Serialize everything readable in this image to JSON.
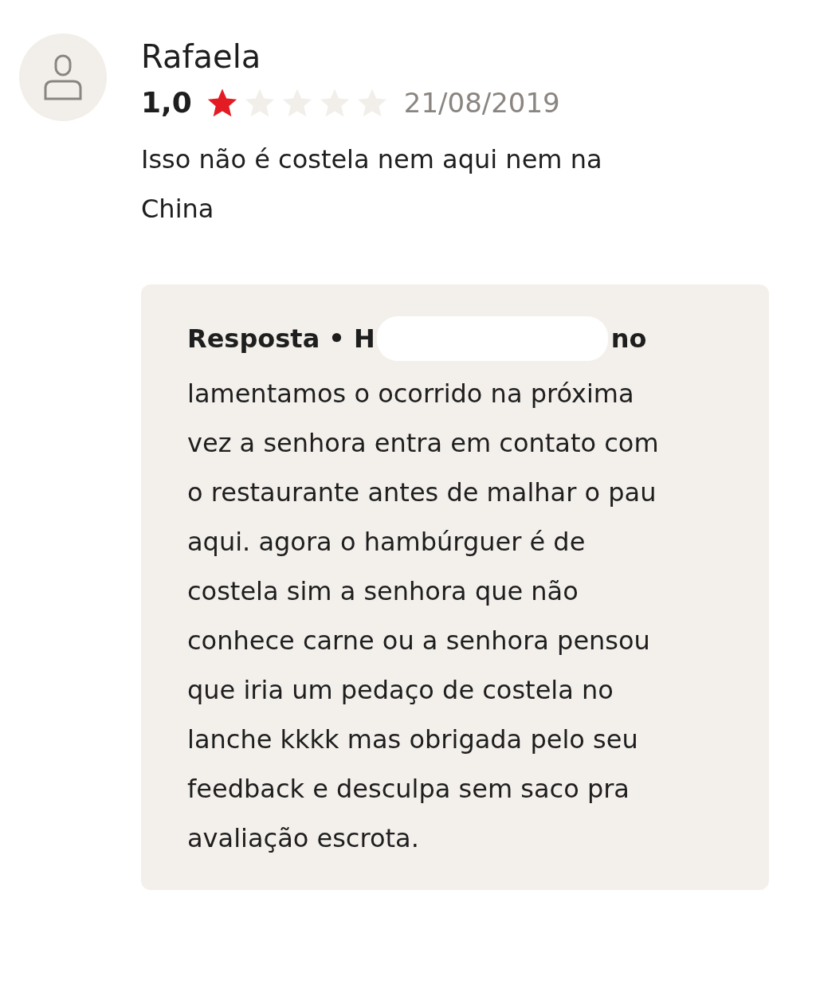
{
  "review": {
    "author": "Rafaela",
    "rating": "1,0",
    "stars": 1,
    "date": "21/08/2019",
    "text": "Isso não é costela nem aqui nem na China"
  },
  "reply": {
    "title": "Resposta • H",
    "title_end": "no",
    "redacted": true,
    "text": "lamentamos o ocorrido na próxima vez a senhora entra em contato com o restaurante antes de malhar o pau aqui. agora o hambúrguer é de costela sim a senhora que não conhece carne ou a senhora pensou que iria um pedaço de costela no lanche kkkk mas obrigada pelo seu feedback e desculpa sem saco pra avaliação escrota."
  }
}
